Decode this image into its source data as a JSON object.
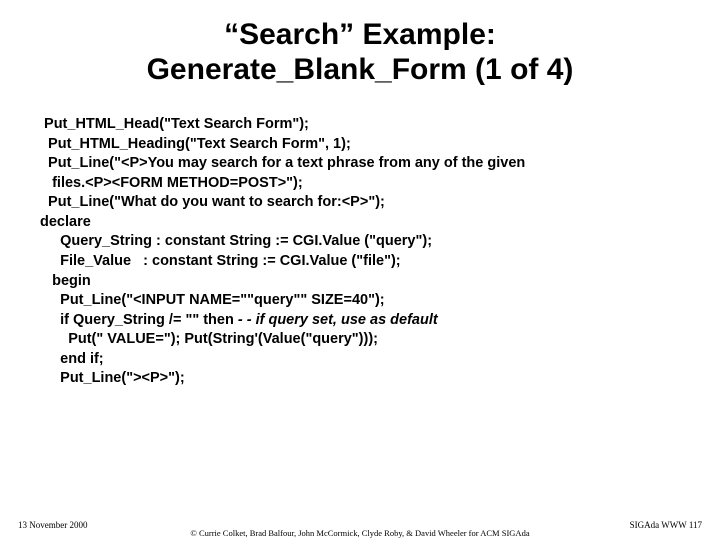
{
  "title_line1": "“Search” Example:",
  "title_line2": "Generate_Blank_Form (1 of 4)",
  "code": {
    "l01": " Put_HTML_Head(\"Text Search Form\");",
    "l02": "  Put_HTML_Heading(\"Text Search Form\", 1);",
    "l03": "  Put_Line(\"<P>You may search for a text phrase from any of the given",
    "l04": "   files.<P><FORM METHOD=POST>\");",
    "l05": "  Put_Line(\"What do you want to search for:<P>\");",
    "l06": "declare",
    "l07": "     Query_String : constant String := CGI.Value (\"query\");",
    "l08": "     File_Value   : constant String := CGI.Value (\"file\");",
    "l09": "   begin",
    "l10": "     Put_Line(\"<INPUT NAME=\"\"query\"\" SIZE=40\");",
    "l11a": "     if Query_String /= \"\" then ",
    "l11b": "- - if query set, use as default",
    "l12": "       Put(\" VALUE=\"); Put(String'(Value(\"query\")));",
    "l13": "     end if;",
    "l14": "     Put_Line(\"><P>\");"
  },
  "footer": {
    "date": "13 November 2000",
    "page": "SIGAda WWW 117",
    "credit": "© Currie Colket, Brad Balfour, John McCormick, Clyde Roby, & David Wheeler for ACM SIGAda"
  }
}
